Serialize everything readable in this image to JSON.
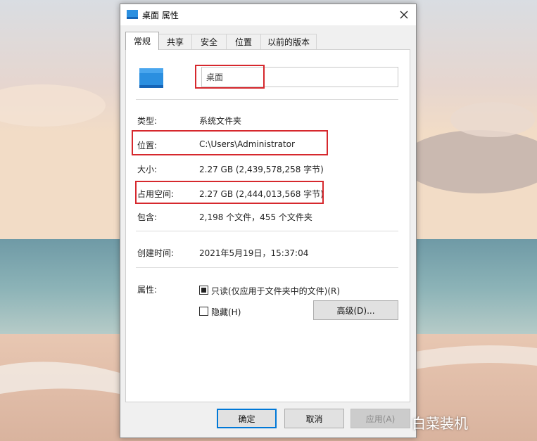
{
  "window": {
    "title": "桌面 属性"
  },
  "tabs": [
    {
      "label": "常规",
      "active": true
    },
    {
      "label": "共享",
      "active": false
    },
    {
      "label": "安全",
      "active": false
    },
    {
      "label": "位置",
      "active": false
    },
    {
      "label": "以前的版本",
      "active": false
    }
  ],
  "general": {
    "name_value": "桌面",
    "type_label": "类型:",
    "type_value": "系统文件夹",
    "location_label": "位置:",
    "location_value": "C:\\Users\\Administrator",
    "size_label": "大小:",
    "size_value": "2.27 GB (2,439,578,258 字节)",
    "disk_size_label": "占用空间:",
    "disk_size_value": "2.27 GB (2,444,013,568 字节)",
    "contains_label": "包含:",
    "contains_value": "2,198 个文件，455 个文件夹",
    "created_label": "创建时间:",
    "created_value": "2021年5月19日，15:37:04",
    "attributes_label": "属性:",
    "readonly_label": "只读(仅应用于文件夹中的文件)(R)",
    "readonly_state": "indeterminate",
    "hidden_label": "隐藏(H)",
    "hidden_state": "unchecked",
    "advanced_button": "高级(D)..."
  },
  "footer": {
    "ok_button": "确定",
    "cancel_button": "取消",
    "apply_button": "应用(A)"
  },
  "watermark": {
    "text": "白菜装机"
  },
  "colors": {
    "highlight_box": "#d6282d",
    "accent": "#0078d7",
    "folder_icon": "#2b8fe0"
  },
  "icons": [
    "folder-icon",
    "close-icon",
    "checkbox-icon"
  ]
}
